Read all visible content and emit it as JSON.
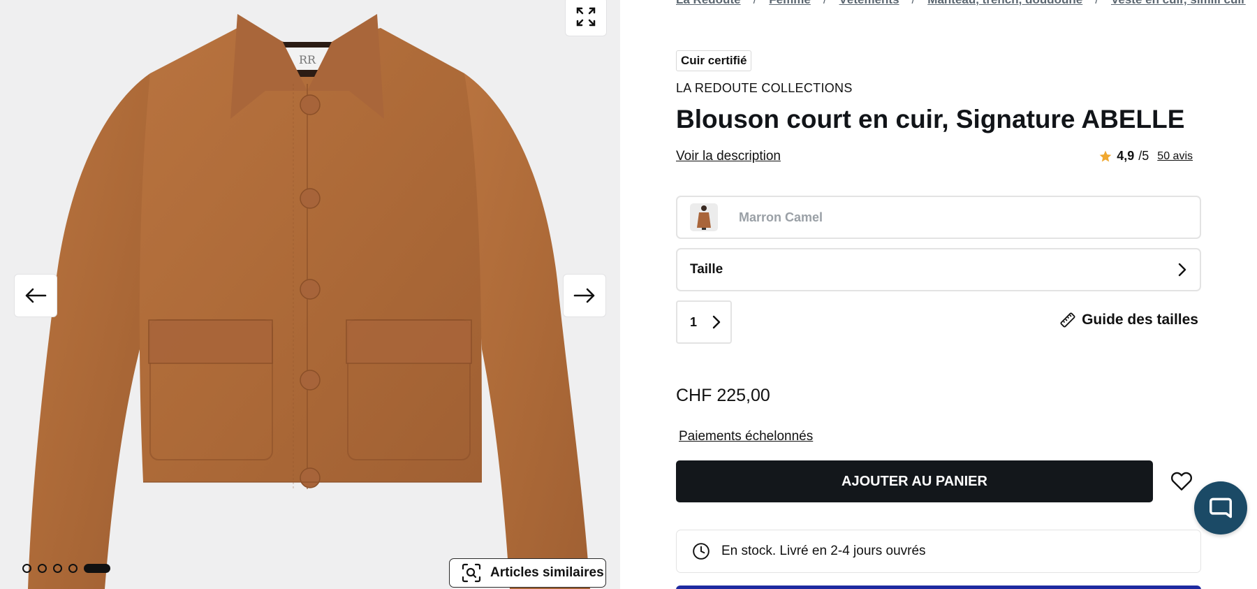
{
  "breadcrumb": [
    "La Redoute",
    "Femme",
    "Vêtements",
    "Manteau, trench, doudoune",
    "Veste en cuir, simili cuir"
  ],
  "product": {
    "badge": "Cuir certifié",
    "brand": "LA REDOUTE COLLECTIONS",
    "title": "Blouson court en cuir, Signature ABELLE",
    "description_link": "Voir la description",
    "rating": {
      "score": "4,9",
      "max": "/5",
      "reviews": "50 avis",
      "star_color": "#f0a830"
    },
    "color": "Marron Camel",
    "size_label": "Taille",
    "quantity": "1",
    "size_guide": "Guide des tailles",
    "price": "CHF 225,00",
    "installments": "Paiements échelonnés",
    "add_to_cart": "AJOUTER AU PANIER",
    "stock": "En stock. Livré en 2-4 jours ouvrés"
  },
  "gallery": {
    "similar_button": "Articles similaires",
    "image_count": 5,
    "active_index": 4,
    "icons": [
      "expand-icon",
      "arrow-left-icon",
      "arrow-right-icon",
      "visual-search-icon"
    ]
  },
  "colors": {
    "primary_button": "#13171b",
    "chat": "#1b4a66",
    "jacket": "#b06a3b"
  }
}
